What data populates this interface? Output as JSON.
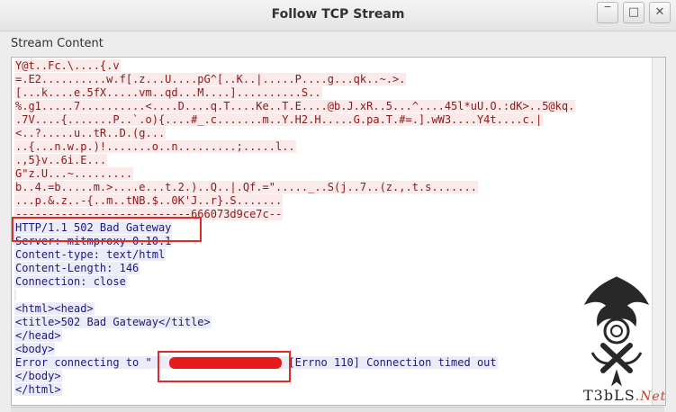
{
  "window": {
    "title": "Follow TCP Stream",
    "minimize_glyph": "‾",
    "maximize_glyph": "□",
    "close_glyph": "✕"
  },
  "stream": {
    "section_label": "Stream Content",
    "client_lines": [
      "Y@t..Fc.\\....{.v",
      "=.E2..........w.f[.z...U....pG^[..K..|.....P....g...qk..~.>.",
      "[...k....e.5fX.....vm..qd...M....]..........S..",
      "%.g1.....7..........<....D....q.T....Ke..T.E....@b.J.xR..5...^....45l*uU.O.:dK>..5@kq.",
      ".7V....{.......P..`.o){....#_.c.......m..Y.H2.H.....G.pa.T.#=.].wW3....Y4t....c.|",
      "<..?.....u..tR..D.(g...",
      "..{...n.w.p.)!.......o..n.........;.....l..",
      ".,5}v..6i.E...",
      "G\"z.U...~.........",
      "b..4.=b.....m.>....e...t.2.)..Q..|.Qf.=\"....._..S(j..7..(z.,.t.s.......",
      "...p.&.z..-{..m..tNB.$..0K'J..r}.S.......",
      "---------------------------666073d9ce7c--"
    ],
    "server_lines": [
      "HTTP/1.1 502 Bad Gateway",
      "Server: mitmproxy 0.10.1",
      "Content-type: text/html",
      "Content-Length: 146",
      "Connection: close",
      "",
      "<html><head>",
      "<title>502 Bad Gateway</title>",
      "</head>",
      "<body>",
      "Error connecting to \"                  \": [Errno 110] Connection timed out",
      "</body>",
      "</html>"
    ]
  },
  "watermark": {
    "text": "T3bLS",
    "suffix": ".Net"
  },
  "colors": {
    "client_bg": "#fbeaea",
    "client_fg": "#8a1818",
    "server_bg": "#ececf8",
    "server_fg": "#1a1a7a",
    "highlight": "#e02b2b"
  }
}
